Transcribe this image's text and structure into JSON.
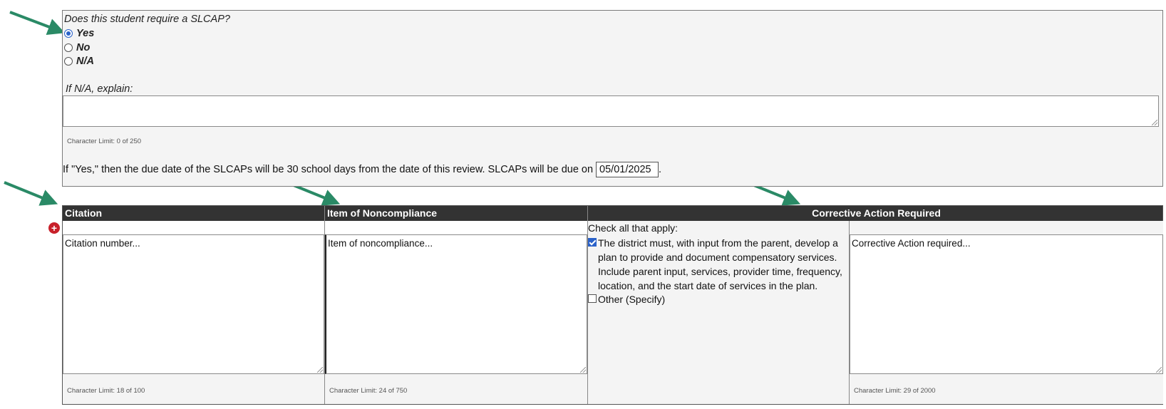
{
  "question": {
    "label": "Does this student require a SLCAP?",
    "options": [
      {
        "label": "Yes",
        "checked": true
      },
      {
        "label": "No",
        "checked": false
      },
      {
        "label": "N/A",
        "checked": false
      }
    ]
  },
  "explain": {
    "label": "If N/A, explain:",
    "value": "",
    "char_limit": "Character Limit: 0 of 250"
  },
  "due": {
    "text": "If \"Yes,\" then the due date of the SLCAPs will be 30 school days from the date of this review. SLCAPs will be due on",
    "date": "05/01/2025",
    "period": "."
  },
  "table": {
    "headers": {
      "citation": "Citation",
      "item": "Item of Noncompliance",
      "corrective": "Corrective Action Required"
    },
    "citation": {
      "value": "Citation number...",
      "char_limit": "Character Limit: 18 of 100"
    },
    "item": {
      "value": "Item of noncompliance...",
      "char_limit": "Character Limit: 24 of 750"
    },
    "checks": {
      "prompt": "Check all that apply:",
      "options": [
        {
          "label": "The district must, with input from the parent, develop a plan to provide and document compensatory services. Include parent input, services, provider time, frequency, location, and the start date of services in the plan.",
          "checked": true
        },
        {
          "label": "Other (Specify)",
          "checked": false
        }
      ]
    },
    "corrective": {
      "value": "Corrective Action required...",
      "char_limit": "Character Limit: 29 of 2000"
    }
  },
  "colors": {
    "header_bg": "#333333",
    "panel_bg": "#f4f4f4",
    "arrow": "#2a8a66",
    "add_icon": "#c8202a",
    "accent": "#2a62c9"
  }
}
